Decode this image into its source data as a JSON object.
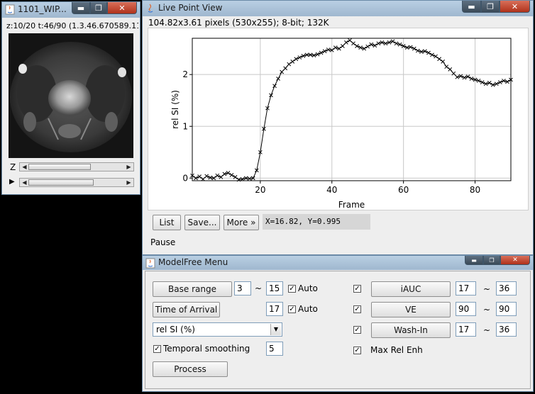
{
  "image_window": {
    "title": "1101_WIP...",
    "info": "z:10/20 t:46/90 (1.3.46.670589.11",
    "z_label": "Z",
    "t_label": "▶"
  },
  "plot_window": {
    "title": "Live Point View",
    "info": "104.82x3.61 pixels (530x255); 8-bit; 132K",
    "buttons": {
      "list": "List",
      "save": "Save...",
      "more": "More »"
    },
    "coords": "X=16.82, Y=0.995",
    "status": "Pause"
  },
  "menu_window": {
    "title": "ModelFree Menu",
    "base_range_label": "Base range",
    "base_from": "3",
    "base_to": "15",
    "auto_label": "Auto",
    "toa_label": "Time of Arrival",
    "toa_value": "17",
    "auto2_label": "Auto",
    "measure_select": "rel SI (%)",
    "temporal_label": "Temporal smoothing",
    "temporal_value": "5",
    "process_label": "Process",
    "iauc_label": "iAUC",
    "iauc_from": "17",
    "iauc_to": "36",
    "ve_label": "VE",
    "ve_from": "90",
    "ve_to": "90",
    "washin_label": "Wash-In",
    "washin_from": "17",
    "washin_to": "36",
    "maxrel_label": "Max Rel Enh",
    "tilde": "~"
  },
  "chart_data": {
    "type": "line",
    "title": "",
    "xlabel": "Frame",
    "ylabel": "rel SI (%)",
    "xlim": [
      1,
      90
    ],
    "ylim": [
      -0.05,
      2.7
    ],
    "xticks": [
      20,
      40,
      60,
      80
    ],
    "yticks": [
      0,
      1,
      2
    ],
    "grid": true,
    "marker": "x",
    "series": [
      {
        "x": [
          1,
          2,
          3,
          4,
          5,
          6,
          7,
          8,
          9,
          10,
          11,
          12,
          13,
          14,
          15,
          16,
          17,
          18,
          19,
          20,
          21,
          22,
          23,
          24,
          25,
          26,
          27,
          28,
          29,
          30,
          31,
          32,
          33,
          34,
          35,
          36,
          37,
          38,
          39,
          40,
          41,
          42,
          43,
          44,
          45,
          46,
          47,
          48,
          49,
          50,
          51,
          52,
          53,
          54,
          55,
          56,
          57,
          58,
          59,
          60,
          61,
          62,
          63,
          64,
          65,
          66,
          67,
          68,
          69,
          70,
          71,
          72,
          73,
          74,
          75,
          76,
          77,
          78,
          79,
          80,
          81,
          82,
          83,
          84,
          85,
          86,
          87,
          88,
          89,
          90
        ],
        "y": [
          0.05,
          0.0,
          0.03,
          -0.02,
          0.04,
          0.01,
          0.0,
          0.05,
          0.02,
          0.08,
          0.1,
          0.06,
          0.02,
          -0.03,
          -0.02,
          0.0,
          -0.01,
          0.0,
          0.15,
          0.5,
          0.95,
          1.35,
          1.6,
          1.78,
          1.92,
          2.05,
          2.12,
          2.2,
          2.25,
          2.3,
          2.33,
          2.36,
          2.38,
          2.38,
          2.37,
          2.39,
          2.42,
          2.45,
          2.48,
          2.47,
          2.52,
          2.5,
          2.55,
          2.62,
          2.66,
          2.6,
          2.55,
          2.52,
          2.5,
          2.54,
          2.58,
          2.56,
          2.6,
          2.62,
          2.6,
          2.62,
          2.64,
          2.6,
          2.58,
          2.55,
          2.52,
          2.53,
          2.5,
          2.46,
          2.44,
          2.45,
          2.42,
          2.38,
          2.35,
          2.3,
          2.25,
          2.15,
          2.1,
          2.02,
          1.95,
          1.97,
          1.94,
          1.96,
          1.92,
          1.9,
          1.88,
          1.85,
          1.82,
          1.84,
          1.8,
          1.82,
          1.85,
          1.88,
          1.86,
          1.9
        ]
      }
    ]
  }
}
